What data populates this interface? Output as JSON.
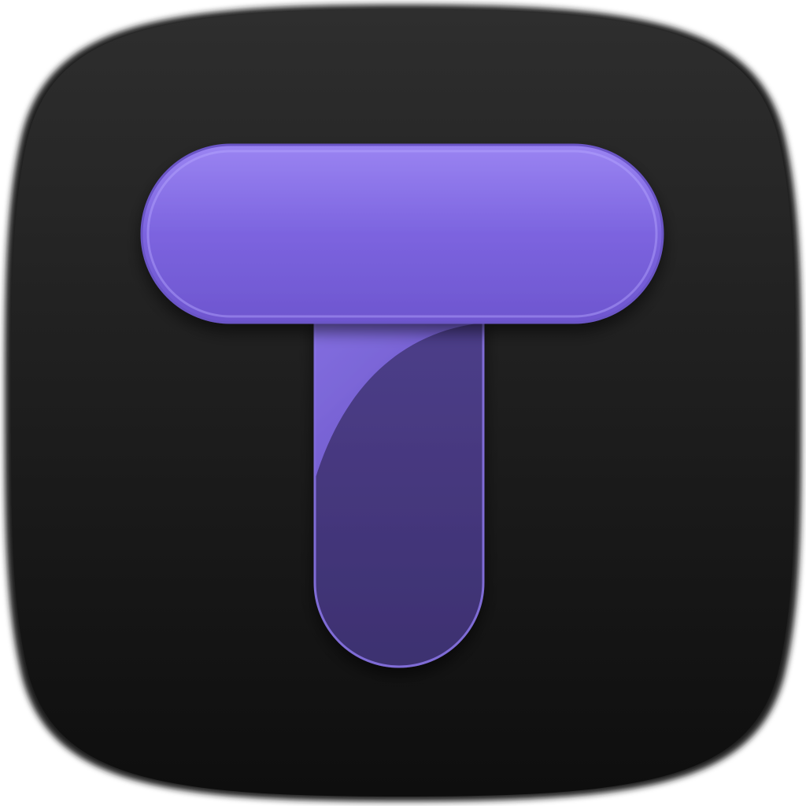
{
  "icon": {
    "name": "t-letter-app-icon",
    "glyph": "T",
    "colors": {
      "background_top": "#2c2c2c",
      "background_bottom": "#0f0f0f",
      "bar_light": "#9b85f2",
      "bar_mid": "#7b63de",
      "bar_dark": "#6a52c8",
      "stem_light": "#8670e6",
      "stem_dark": "#3f3470",
      "outline": "#a996ff"
    }
  }
}
